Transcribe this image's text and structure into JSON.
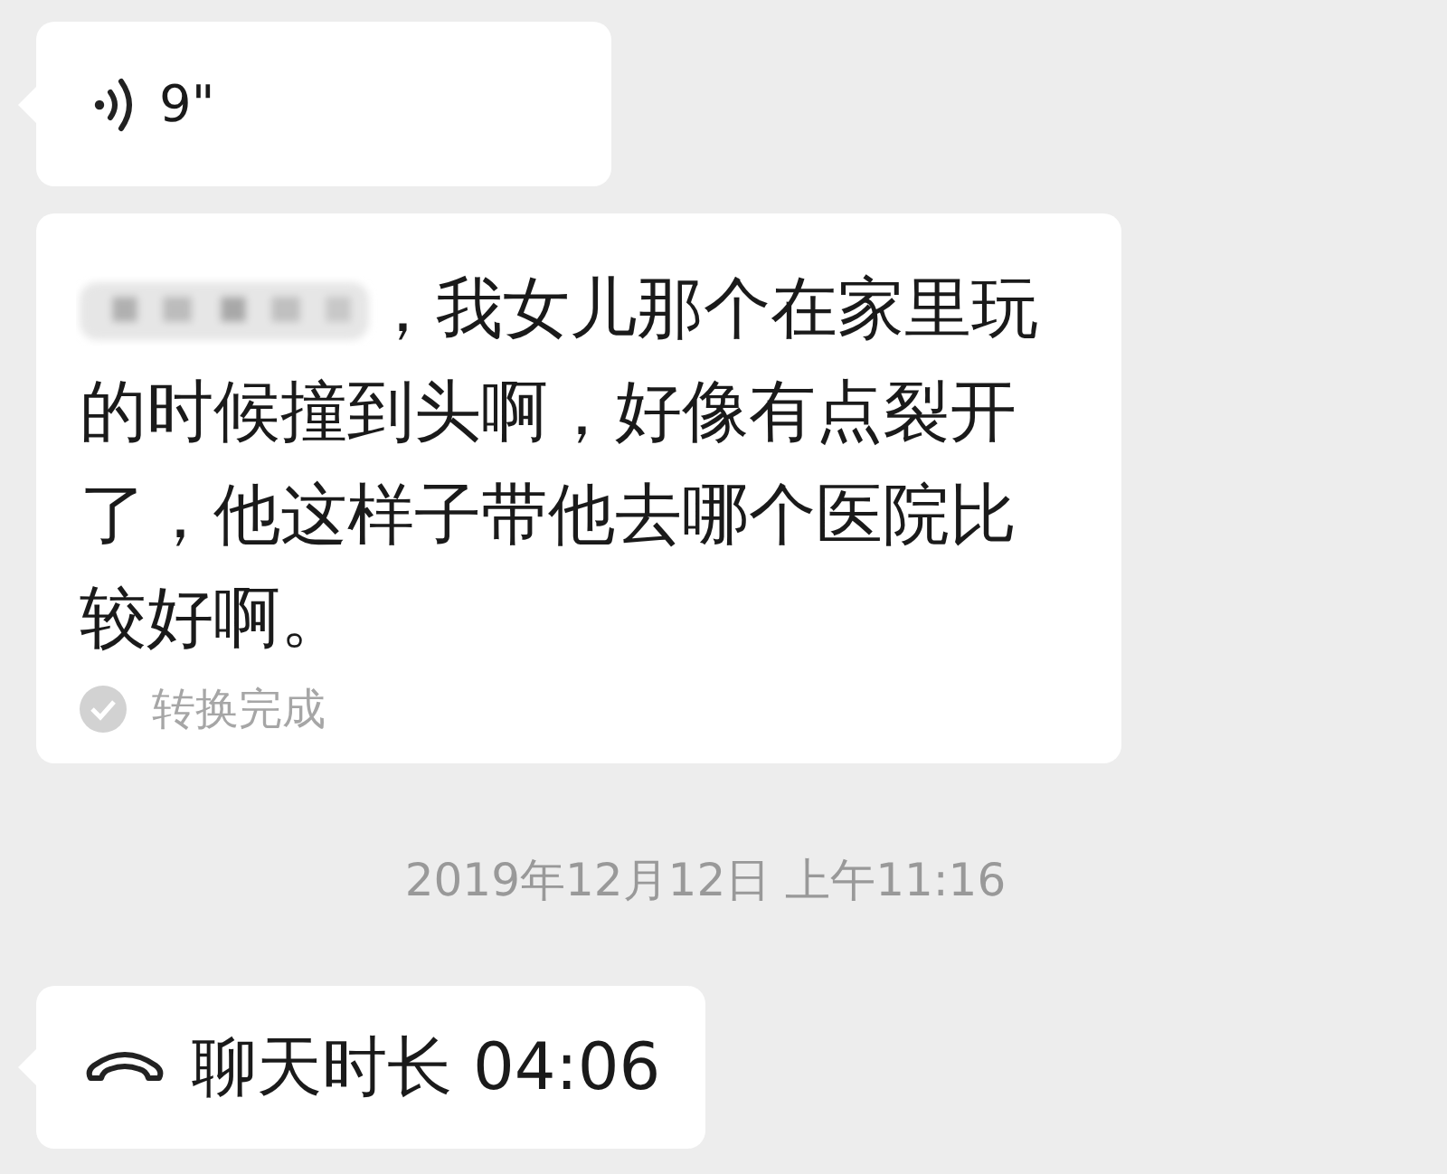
{
  "messages": [
    {
      "kind": "voice",
      "duration": "9\""
    },
    {
      "kind": "transcript",
      "redacted_prefix": true,
      "text": "，我女儿那个在家里玩的时候撞到头啊，好像有点裂开了，他这样子带他去哪个医院比较好啊。",
      "status": "转换完成"
    },
    {
      "kind": "timestamp",
      "text": "2019年12月12日 上午11:16"
    },
    {
      "kind": "call",
      "text": "聊天时长 04:06"
    }
  ]
}
